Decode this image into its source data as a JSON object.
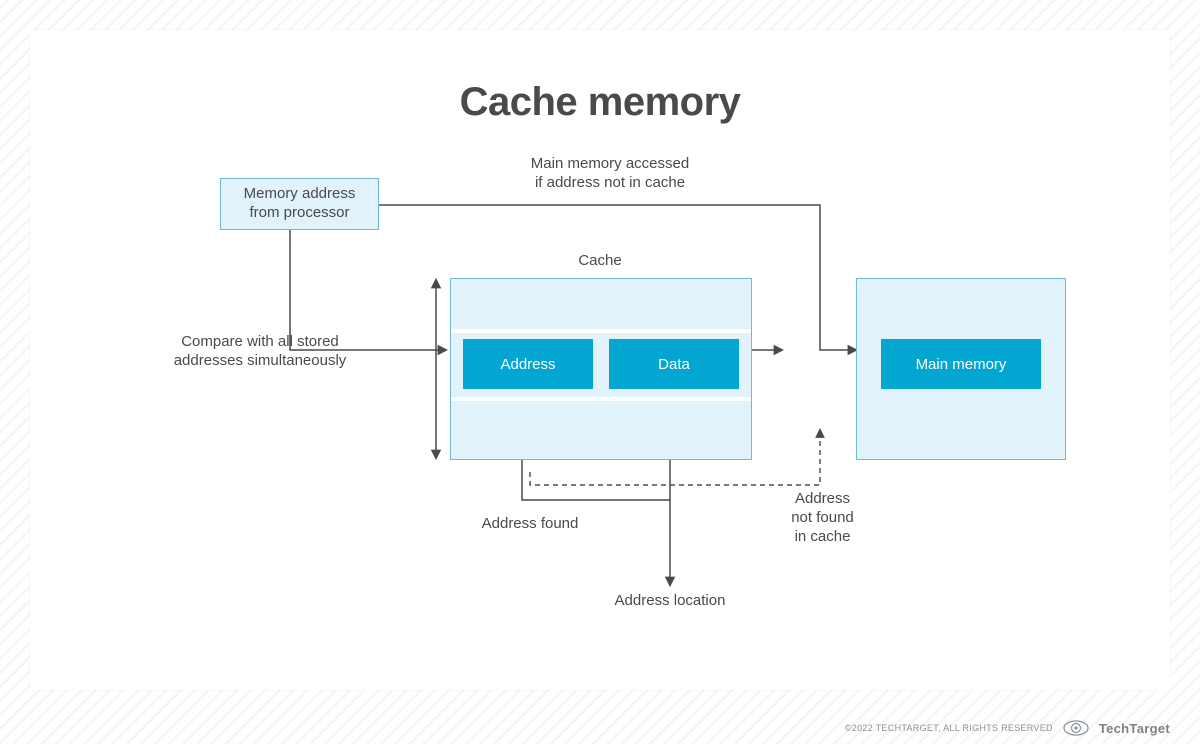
{
  "title": "Cache memory",
  "labels": {
    "main_memory_accessed": "Main memory accessed\nif address not in cache",
    "memory_address_from_processor": "Memory address\nfrom processor",
    "compare_with_all": "Compare with all stored\naddresses simultaneously",
    "cache_label": "Cache",
    "address_box": "Address",
    "data_box": "Data",
    "main_memory_box": "Main memory",
    "address_found": "Address found",
    "address_not_found": "Address\nnot found\nin cache",
    "address_location": "Address location"
  },
  "colors": {
    "light_blue": "#e1f2fb",
    "light_blue_border": "#6fb8d8",
    "cyan": "#03a6d1",
    "text": "#4a4a4a",
    "arrow": "#4a4a4a"
  },
  "footer": {
    "copyright": "©2022 TECHTARGET, ALL RIGHTS RESERVED",
    "brand": "TechTarget"
  }
}
